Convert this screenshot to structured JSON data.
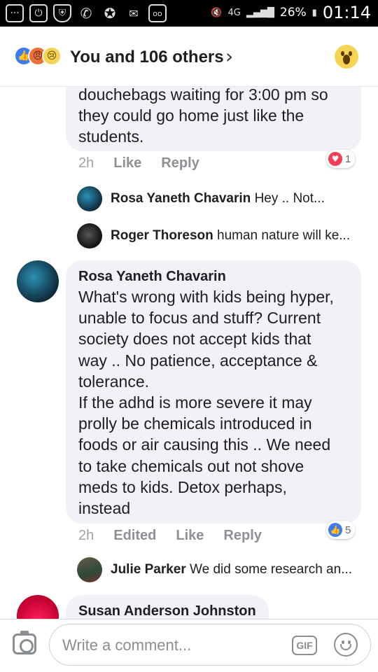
{
  "status_bar": {
    "battery": "26%",
    "time": "01:14",
    "network": "4G"
  },
  "header": {
    "reactions_text": "You and 106 others",
    "reaction_icons": [
      "like-icon",
      "angry-icon",
      "sad-icon"
    ]
  },
  "comments": [
    {
      "text": "douchebags waiting for 3:00 pm so\nthey could go home just like the\nstudents.",
      "time": "2h",
      "like": "Like",
      "reply": "Reply",
      "reaction_count": "1",
      "reaction_type": "love",
      "replies": [
        {
          "name": "Rosa Yaneth Chavarin",
          "text": "Hey .. Not..."
        },
        {
          "name": "Roger Thoreson",
          "text": "human nature will ke..."
        }
      ]
    },
    {
      "author": "Rosa Yaneth Chavarin",
      "text": "What's wrong with kids being hyper,\nunable to focus and stuff? Current\nsociety does not accept kids that\nway .. No patience, acceptance &\ntolerance.\nIf the adhd is more severe it may\nprolly be chemicals introduced in\nfoods or air causing this .. We need\nto take chemicals out not shove\nmeds to kids. Detox perhaps,\ninstead",
      "time": "2h",
      "edited": "Edited",
      "like": "Like",
      "reply": "Reply",
      "reaction_count": "5",
      "reaction_type": "like",
      "replies": [
        {
          "name": "Julie Parker",
          "text": "We did some research an..."
        }
      ]
    },
    {
      "author": "Susan Anderson Johnston"
    }
  ],
  "composer": {
    "placeholder": "Write a comment...",
    "gif_label": "GIF"
  }
}
